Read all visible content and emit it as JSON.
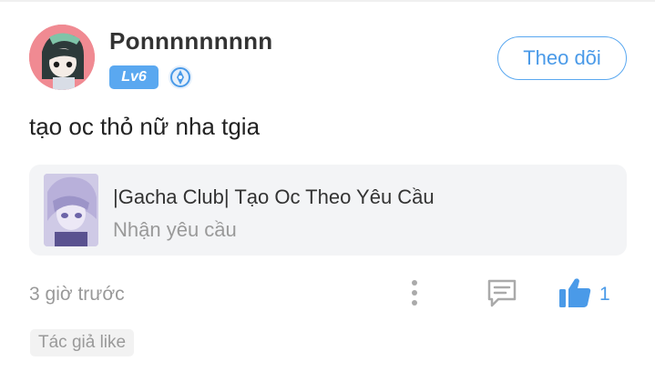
{
  "post": {
    "author": {
      "username": "Ponnnnnnnnn",
      "level": "Lv6"
    },
    "follow_label": "Theo dõi",
    "text": "tạo oc thỏ nữ nha tgia",
    "linked_card": {
      "title": "|Gacha Club| Tạo Oc Theo Yêu Cầu",
      "subtitle": "Nhận yêu cầu"
    },
    "timestamp": "3 giờ trước",
    "like_count": "1",
    "tag": "Tác giả like"
  },
  "colors": {
    "accent": "#4a9ae8",
    "level_badge": "#5aa8f0",
    "avatar_bg": "#f08a92",
    "muted_text": "#999999",
    "card_bg": "#f3f4f6"
  },
  "icons": {
    "medal": "medal-icon",
    "more": "more-vertical-icon",
    "comment": "comment-icon",
    "like": "thumbs-up-icon"
  }
}
